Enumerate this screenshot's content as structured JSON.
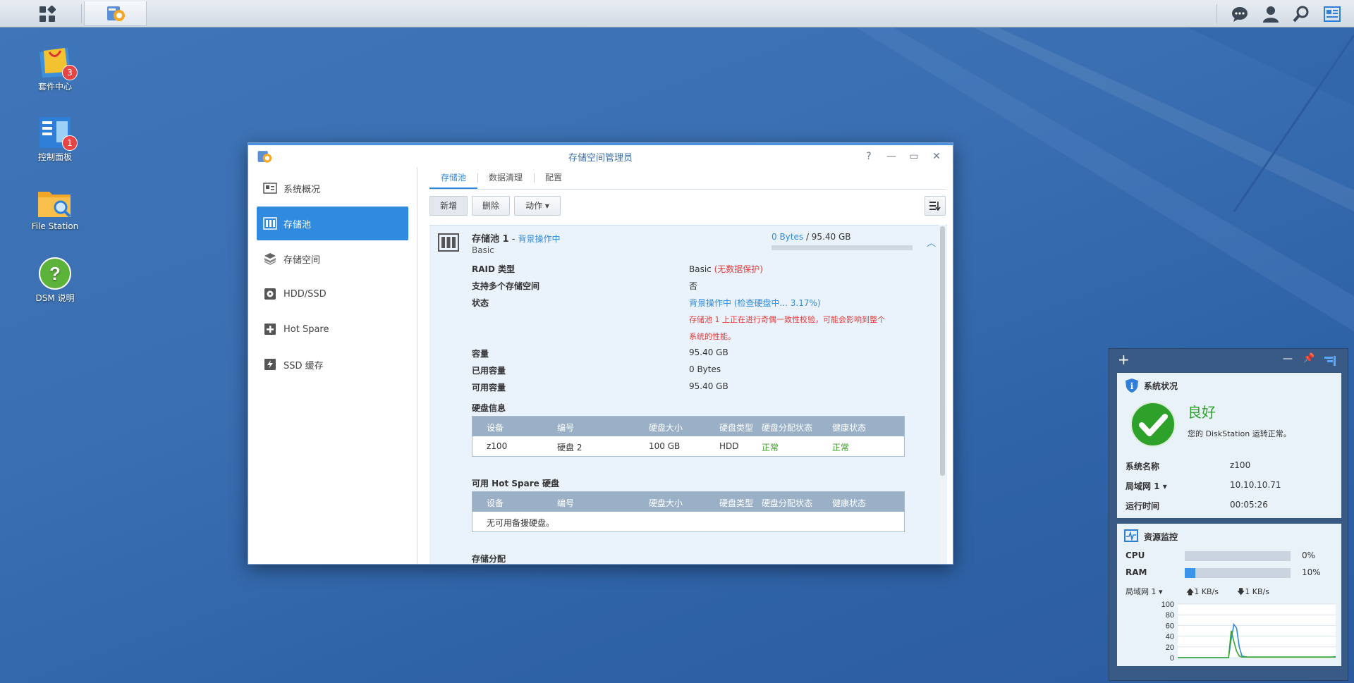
{
  "desktop": {
    "icons": [
      {
        "label": "套件中心",
        "badge": "3"
      },
      {
        "label": "控制面板",
        "badge": "1"
      },
      {
        "label": "File Station"
      },
      {
        "label": "DSM 说明"
      }
    ]
  },
  "window": {
    "title": "存储空间管理员",
    "sidebar": [
      "系统概况",
      "存储池",
      "存储空间",
      "HDD/SSD",
      "Hot Spare",
      "SSD 缓存"
    ],
    "tabs": [
      "存储池",
      "数据清理",
      "配置"
    ],
    "toolbar": {
      "add": "新增",
      "delete": "删除",
      "action": "动作"
    },
    "pool": {
      "name": "存储池 1",
      "sep": " - ",
      "status_short": "背景操作中",
      "type": "Basic",
      "used": "0 Bytes",
      "slash": " / ",
      "total": "95.40 GB",
      "usage_fraction": 0.0,
      "fields": [
        {
          "label": "RAID 类型",
          "value": "Basic",
          "note": "(无数据保护)"
        },
        {
          "label": "支持多个存储空间",
          "value": "否"
        },
        {
          "label": "状态",
          "value": "背景操作中",
          "note": "(检查硬盘中... 3.17%)",
          "warn1": "存储池 1 上正在进行奇偶一致性校验，可能会影响到整个",
          "warn2": "系统的性能。"
        },
        {
          "label": "容量",
          "value": "95.40 GB"
        },
        {
          "label": "已用容量",
          "value": "0 Bytes"
        },
        {
          "label": "可用容量",
          "value": "95.40 GB"
        }
      ],
      "disk_info_title": "硬盘信息",
      "columns": [
        "设备",
        "编号",
        "硬盘大小",
        "硬盘类型",
        "硬盘分配状态",
        "健康状态"
      ],
      "disks": [
        {
          "device": "z100",
          "num": "硬盘 2",
          "size": "100 GB",
          "type": "HDD",
          "alloc": "正常",
          "health": "正常"
        }
      ],
      "hotspare_title": "可用 Hot Spare 硬盘",
      "hotspare_empty": "无可用备援硬盘。",
      "alloc_title": "存储分配"
    }
  },
  "widgets": {
    "status": {
      "title": "系统状况",
      "state": "良好",
      "desc": "您的 DiskStation 运转正常。",
      "rows": [
        {
          "label": "系统名称",
          "value": "z100"
        },
        {
          "label": "局域网 1",
          "value": "10.10.10.71"
        },
        {
          "label": "运行时间",
          "value": "00:05:26"
        }
      ]
    },
    "monitor": {
      "title": "资源监控",
      "cpu_label": "CPU",
      "cpu": "0%",
      "cpu_fraction": 0.0,
      "ram_label": "RAM",
      "ram": "10%",
      "ram_fraction": 0.1,
      "net_label": "局域网 1",
      "up": "1 KB/s",
      "down": "1 KB/s",
      "chart_data": {
        "type": "line",
        "y_ticks": [
          "100",
          "80",
          "60",
          "40",
          "20",
          "0"
        ],
        "ylim": [
          0,
          100
        ],
        "series": [
          {
            "color": "#2f8ae0",
            "values": [
              0,
              0,
              0,
              0,
              0,
              0,
              0,
              0,
              0,
              0,
              0,
              0,
              0,
              0,
              0,
              0,
              0,
              0,
              0,
              0,
              35,
              62,
              55,
              20,
              3,
              2,
              1,
              1,
              1,
              1,
              1,
              1,
              1,
              1,
              1,
              1,
              1,
              1,
              1,
              1,
              1,
              1,
              1,
              1,
              1,
              1,
              1,
              1,
              1,
              1,
              1,
              1,
              1,
              1,
              1,
              1,
              1,
              1,
              1,
              2
            ]
          },
          {
            "color": "#3aa62a",
            "values": [
              0,
              0,
              0,
              0,
              0,
              0,
              0,
              0,
              0,
              0,
              0,
              0,
              0,
              0,
              0,
              0,
              0,
              0,
              0,
              0,
              50,
              30,
              12,
              3,
              1,
              1,
              1,
              1,
              1,
              1,
              1,
              1,
              1,
              1,
              1,
              1,
              1,
              1,
              1,
              1,
              1,
              1,
              1,
              1,
              1,
              1,
              1,
              1,
              1,
              1,
              1,
              1,
              1,
              1,
              1,
              1,
              1,
              1,
              1,
              1
            ]
          }
        ]
      }
    }
  }
}
